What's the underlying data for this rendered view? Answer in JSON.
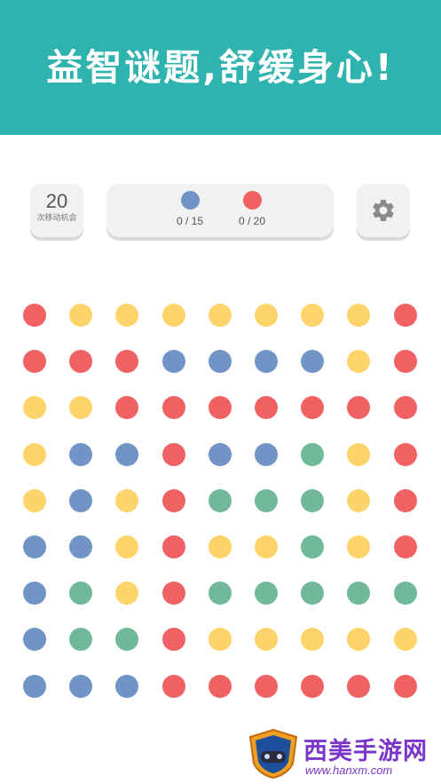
{
  "banner": {
    "title": "益智谜题,舒缓身心!"
  },
  "moves": {
    "count": "20",
    "label": "次移动机会"
  },
  "goals": [
    {
      "color_name": "blue",
      "color": "#7094c5",
      "progress": "0 / 15"
    },
    {
      "color_name": "red",
      "color": "#ef6163",
      "progress": "0 / 20"
    }
  ],
  "settings": {
    "icon": "gear-icon"
  },
  "palette": {
    "R": "#ef6163",
    "Y": "#fdd46a",
    "B": "#7094c5",
    "G": "#6fb99a"
  },
  "board": [
    [
      "R",
      "Y",
      "Y",
      "Y",
      "Y",
      "Y",
      "Y",
      "Y",
      "R"
    ],
    [
      "R",
      "R",
      "R",
      "B",
      "B",
      "B",
      "B",
      "Y",
      "R"
    ],
    [
      "Y",
      "Y",
      "R",
      "R",
      "R",
      "R",
      "R",
      "R",
      "R"
    ],
    [
      "Y",
      "B",
      "B",
      "R",
      "B",
      "B",
      "G",
      "Y",
      "R"
    ],
    [
      "Y",
      "B",
      "Y",
      "R",
      "G",
      "G",
      "G",
      "Y",
      "R"
    ],
    [
      "B",
      "B",
      "Y",
      "R",
      "Y",
      "Y",
      "G",
      "Y",
      "R"
    ],
    [
      "B",
      "G",
      "Y",
      "R",
      "G",
      "G",
      "G",
      "G",
      "G"
    ],
    [
      "B",
      "G",
      "G",
      "R",
      "Y",
      "Y",
      "Y",
      "Y",
      "Y"
    ],
    [
      "B",
      "B",
      "B",
      "R",
      "R",
      "R",
      "R",
      "R",
      "R"
    ]
  ],
  "watermark": {
    "title": "西美手游网",
    "url": "www.hanxm.com"
  }
}
